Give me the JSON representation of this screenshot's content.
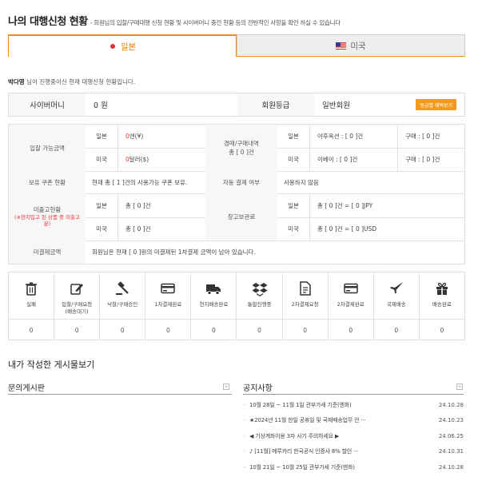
{
  "header": {
    "title": "나의 대행신청 현황",
    "subtitle": "- 회원님의 입찰/구매대행 신청 현황 및 사이버머니 충전 현황 등의 전반적인 사항을 확인 하실 수 있습니다"
  },
  "tabs": [
    {
      "label": "일본",
      "flag": "japan-flag-icon",
      "active": true
    },
    {
      "label": "미국",
      "flag": "usa-flag-icon",
      "active": false
    }
  ],
  "greeting": {
    "name": "박다영",
    "text": " 님이 진행중이신 현재 대행신청 현황입니다."
  },
  "summary": {
    "cyber_money_label": "사이버머니",
    "cyber_money_value": "0 원",
    "grade_label": "회원등급",
    "grade_value": "일반회원",
    "benefit_button": "등급별 혜택보기"
  },
  "bid_amount": {
    "label": "입찰 가능금액",
    "japan_label": "일본",
    "japan_value": "0",
    "japan_unit": "엔(¥)",
    "usa_label": "미국",
    "usa_value": "0",
    "usa_unit": "달러($)"
  },
  "history": {
    "label": "경매/구매내역",
    "total": "총 [ 0 ]건",
    "japan_label": "일본",
    "yahoo": "야후옥션 : [ 0 ]건",
    "japan_buy": "구매 : [ 0 ]건",
    "usa_label": "미국",
    "ebay": "이베이 : [ 0 ]건",
    "usa_buy": "구매 : [ 0 ]건"
  },
  "coupon": {
    "label": "보유 쿠폰 현황",
    "value": "현재 총 [ 1 ]건의 사용가능 쿠폰 보유."
  },
  "auto_pay": {
    "label": "자동 결제 여부",
    "value": "사용하지 않음"
  },
  "unstocked": {
    "label": "미출고현황",
    "note": "(※현지입고 된 상품 중 미출고분)",
    "japan_label": "일본",
    "japan_value": "총 [ 0 ]건",
    "usa_label": "미국",
    "usa_value": "총 [ 0 ]건"
  },
  "storage": {
    "label": "창고보관료",
    "japan_label": "일본",
    "japan_value": "총 [ 0 ]건 = [ 0 ]JPY",
    "usa_label": "미국",
    "usa_value": "총 [ 0 ]건 = [ 0 ]USD"
  },
  "unpaid": {
    "label": "미결제금액",
    "value": "회원님은 현재 [ 0 ]원의 미결제된 1차결제 금액이 남아 있습니다."
  },
  "status_items": [
    {
      "icon": "trash-icon",
      "label": "실패",
      "count": "0"
    },
    {
      "icon": "edit-icon",
      "label": "입찰/구매요청",
      "sub": "(배송대기)",
      "count": "0"
    },
    {
      "icon": "gavel-icon",
      "label": "낙찰/구매승인",
      "count": "0"
    },
    {
      "icon": "card-icon",
      "label": "1차결제완료",
      "count": "0"
    },
    {
      "icon": "truck-icon",
      "label": "현지배송완료",
      "count": "0"
    },
    {
      "icon": "boxes-icon",
      "label": "통합진행중",
      "count": "0"
    },
    {
      "icon": "document-icon",
      "label": "2차결제요청",
      "count": "0"
    },
    {
      "icon": "card-icon",
      "label": "2차결제완료",
      "count": "0"
    },
    {
      "icon": "plane-icon",
      "label": "국제배송",
      "count": "0"
    },
    {
      "icon": "gift-icon",
      "label": "배송완료",
      "count": "0"
    }
  ],
  "posts_title": "내가 작성한 게시물보기",
  "inquiry_title": "문의게시판",
  "notice_title": "공지사항",
  "more_symbol": "+",
  "notices": [
    {
      "title": "10월 28일 ~ 11월 1일 관부가세 기준(엔화)",
      "date": "24.10.28"
    },
    {
      "title": "★2024년 11월 한일 공휴일 및 국제배송업무 안 ···",
      "date": "24.10.23"
    },
    {
      "title": "◀ 기상계좌이용 3자 사기 주의하세요 ▶",
      "date": "24.06.25"
    },
    {
      "title": "♪ [11월] 메루카리 한국공식 인증샤 8% 할인 ···",
      "date": "24.10.31"
    },
    {
      "title": "10월 21일 ~ 10월 25일 관부가세 기준(엔화)",
      "date": "24.10.28"
    }
  ],
  "colors": {
    "accent": "#f08c1e",
    "red": "#ee3333"
  }
}
